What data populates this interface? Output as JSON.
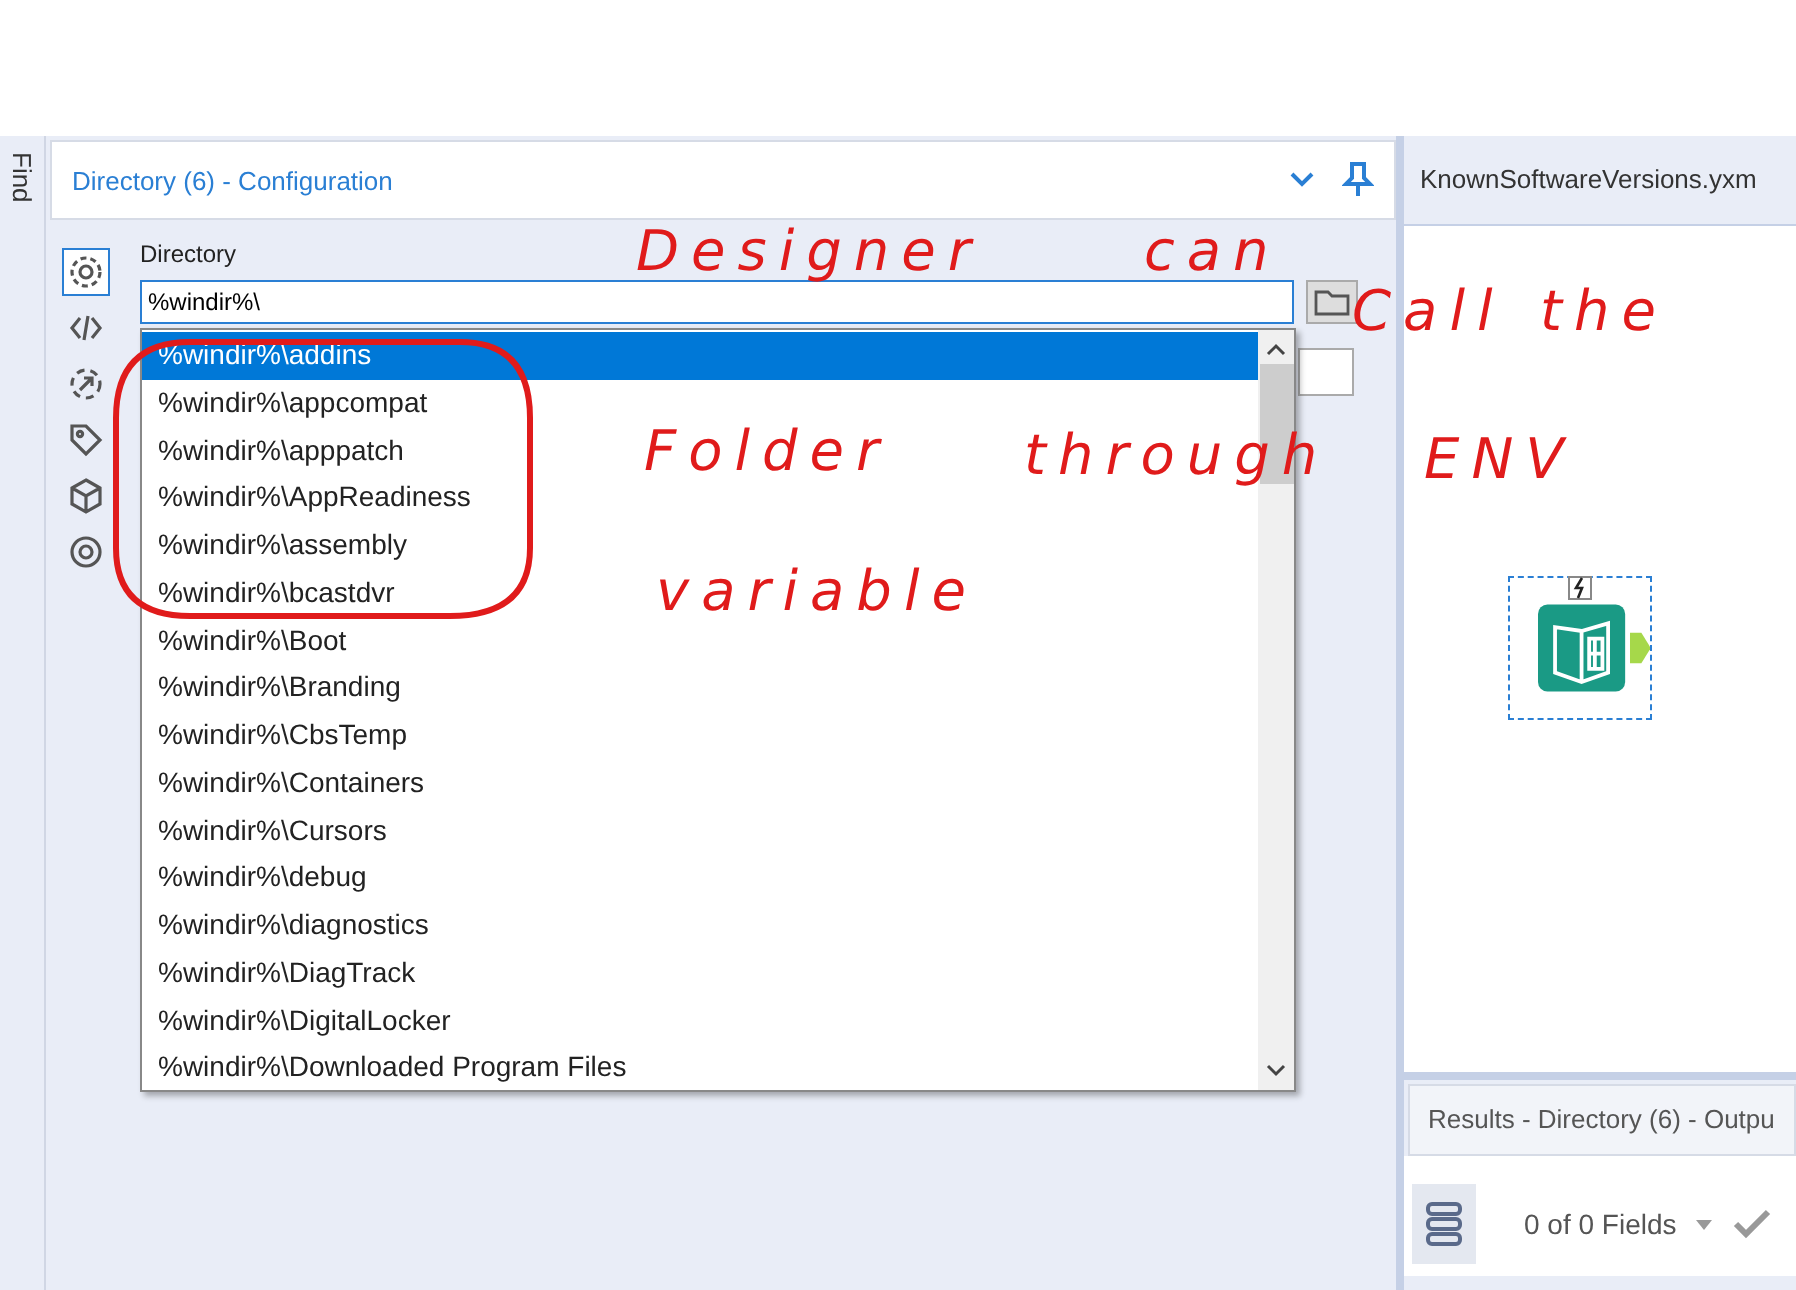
{
  "side_tab": {
    "label": "Find"
  },
  "config_panel": {
    "title": "Directory (6) - Configuration",
    "field_label": "Directory",
    "directory_field": {
      "value": "%windir%\\"
    },
    "tool_tabs": [
      {
        "selected": true
      },
      {
        "selected": false
      },
      {
        "selected": false
      },
      {
        "selected": false
      },
      {
        "selected": false
      },
      {
        "selected": false
      }
    ],
    "suggestions": [
      {
        "text": "%windir%\\addins",
        "selected": true
      },
      {
        "text": "%windir%\\appcompat",
        "selected": false
      },
      {
        "text": "%windir%\\apppatch",
        "selected": false
      },
      {
        "text": "%windir%\\AppReadiness",
        "selected": false
      },
      {
        "text": "%windir%\\assembly",
        "selected": false
      },
      {
        "text": "%windir%\\bcastdvr",
        "selected": false
      },
      {
        "text": "%windir%\\Boot",
        "selected": false
      },
      {
        "text": "%windir%\\Branding",
        "selected": false
      },
      {
        "text": "%windir%\\CbsTemp",
        "selected": false
      },
      {
        "text": "%windir%\\Containers",
        "selected": false
      },
      {
        "text": "%windir%\\Cursors",
        "selected": false
      },
      {
        "text": "%windir%\\debug",
        "selected": false
      },
      {
        "text": "%windir%\\diagnostics",
        "selected": false
      },
      {
        "text": "%windir%\\DiagTrack",
        "selected": false
      },
      {
        "text": "%windir%\\DigitalLocker",
        "selected": false
      },
      {
        "text": "%windir%\\Downloaded Program Files",
        "selected": false
      }
    ]
  },
  "canvas_tab": {
    "title": "KnownSoftwareVersions.yxm"
  },
  "results_panel": {
    "title": "Results - Directory (6) - Outpu",
    "fields_count": "0 of 0 Fields"
  },
  "annotation": {
    "words": [
      "Designer",
      "can",
      "Call",
      "the",
      "Folder",
      "through",
      "ENV",
      "variable"
    ]
  }
}
